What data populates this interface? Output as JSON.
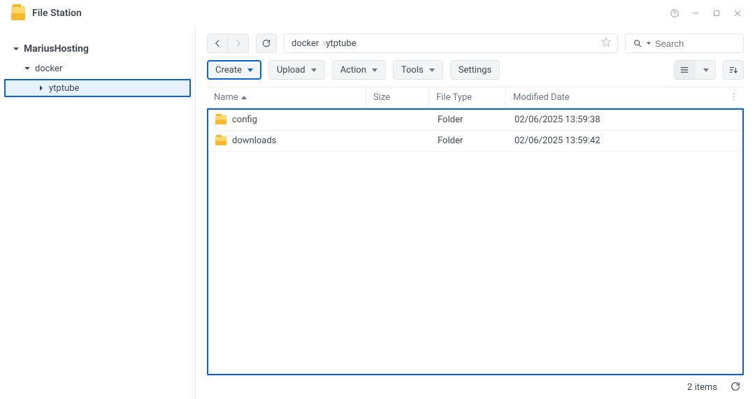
{
  "app_title": "File Station",
  "sidebar": {
    "root": "MariusHosting",
    "items": [
      {
        "label": "docker"
      },
      {
        "label": "ytptube"
      }
    ]
  },
  "breadcrumb": [
    "docker",
    "ytptube"
  ],
  "search": {
    "placeholder": "Search"
  },
  "toolbar": {
    "create": "Create",
    "upload": "Upload",
    "action": "Action",
    "tools": "Tools",
    "settings": "Settings"
  },
  "columns": {
    "name": "Name",
    "size": "Size",
    "type": "File Type",
    "modified": "Modified Date"
  },
  "rows": [
    {
      "name": "config",
      "size": "",
      "type": "Folder",
      "modified": "02/06/2025 13:59:38"
    },
    {
      "name": "downloads",
      "size": "",
      "type": "Folder",
      "modified": "02/06/2025 13:59:42"
    }
  ],
  "status": {
    "items_label": "2 items"
  }
}
